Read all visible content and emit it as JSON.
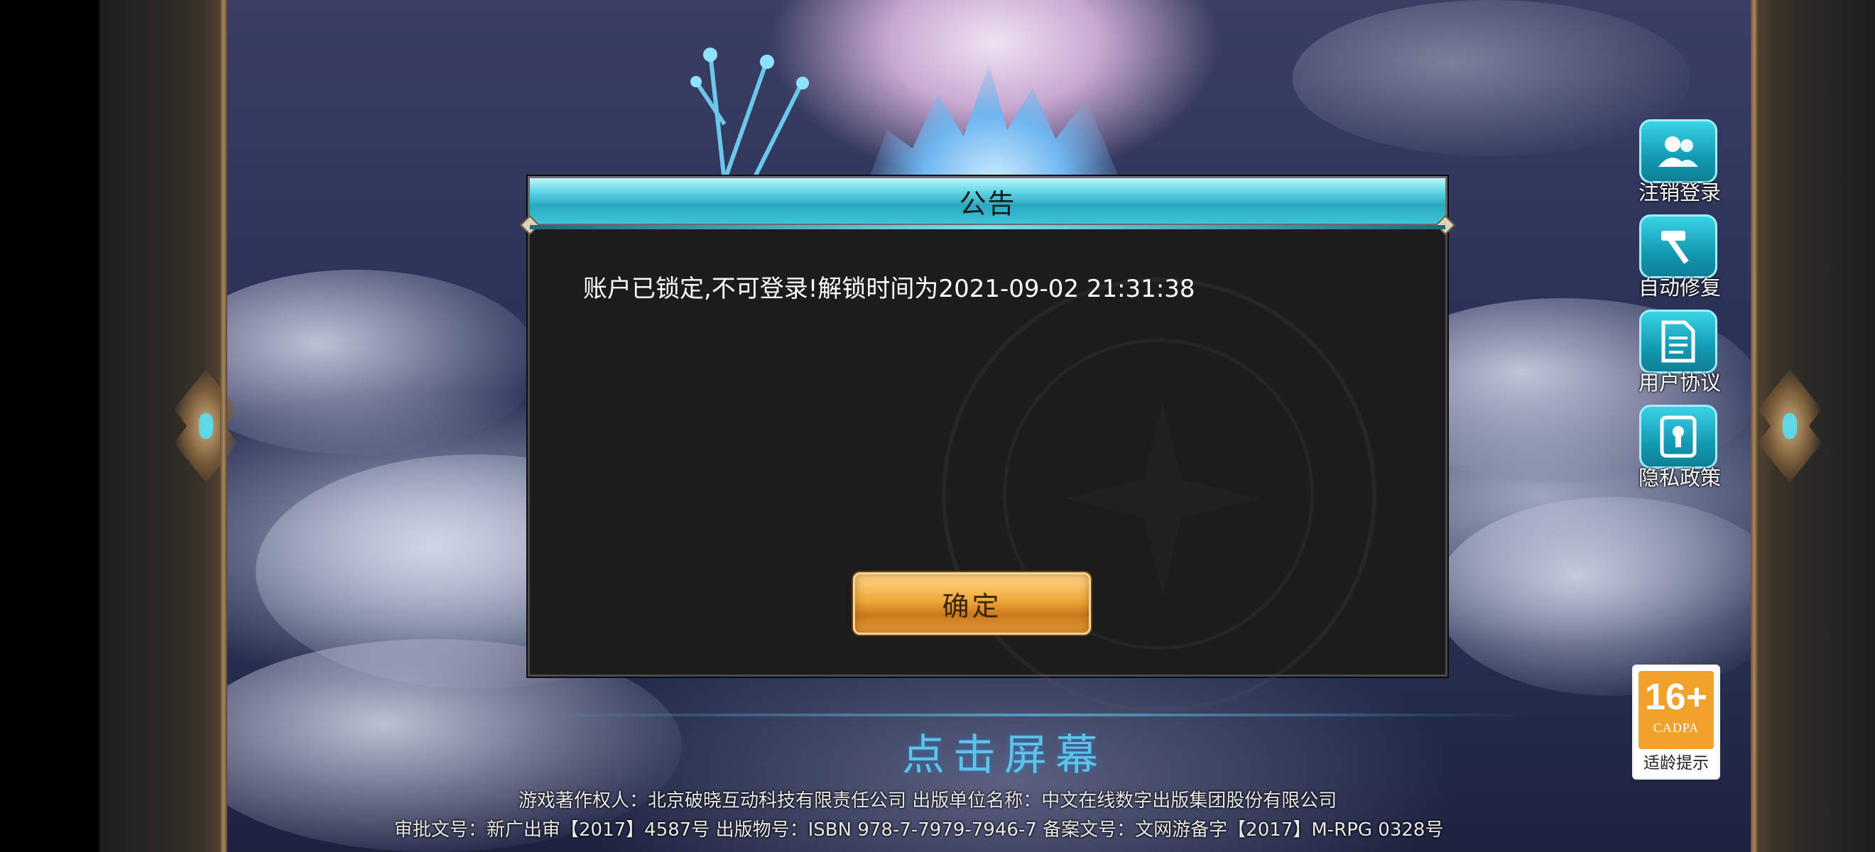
{
  "dialog": {
    "title": "公告",
    "message": "账户已锁定,不可登录!解锁时间为2021-09-02 21:31:38",
    "confirm_label": "确定"
  },
  "side_menu": {
    "items": [
      {
        "label": "注销登录",
        "icon": "users-icon"
      },
      {
        "label": "自动修复",
        "icon": "hammer-icon"
      },
      {
        "label": "用户协议",
        "icon": "document-icon"
      },
      {
        "label": "隐私政策",
        "icon": "keyhole-icon"
      }
    ]
  },
  "age_rating": {
    "rating": "16+",
    "org": "CADPA",
    "caption": "适龄提示"
  },
  "tap_prompt": "点击屏幕",
  "footer": {
    "line1": "游戏著作权人：北京破晓互动科技有限责任公司 出版单位名称：中文在线数字出版集团股份有限公司",
    "line2": "审批文号：新广出审【2017】4587号   出版物号：ISBN 978-7-7979-7946-7   备案文号：文网游备字【2017】M-RPG 0328号"
  },
  "colors": {
    "accent_cyan": "#2aa8bf",
    "button_gold": "#f0a83a",
    "dialog_bg": "#1c1c1d",
    "age_orange": "#f0a22c",
    "prompt_blue": "#5fc3e8"
  }
}
